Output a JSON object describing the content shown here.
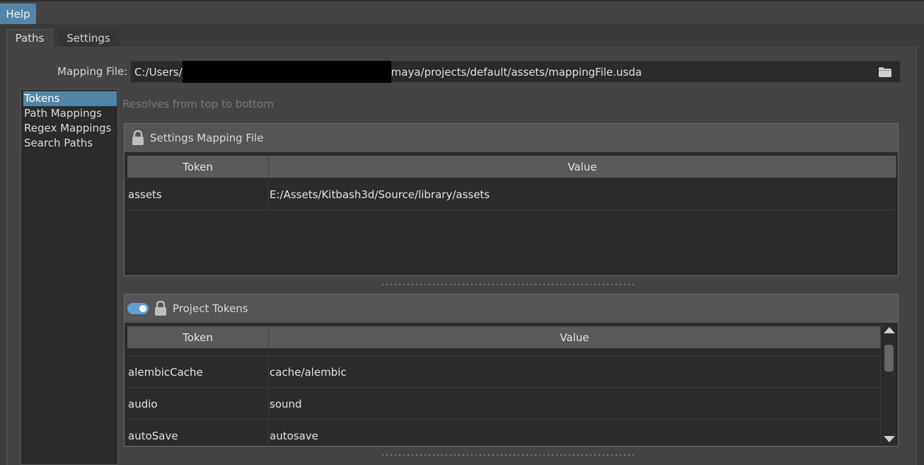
{
  "menu": {
    "help_label": "Help"
  },
  "tabs": [
    {
      "label": "Paths"
    },
    {
      "label": "Settings"
    }
  ],
  "mapping_file": {
    "label": "Mapping File:",
    "value_prefix": "C:/Users/",
    "value_suffix": "maya/projects/default/assets/mappingFile.usda"
  },
  "nav": {
    "items": [
      {
        "label": "Tokens",
        "selected": true
      },
      {
        "label": "Path Mappings"
      },
      {
        "label": "Regex Mappings"
      },
      {
        "label": "Search Paths"
      }
    ]
  },
  "resolves_hint": "Resolves from top to bottom",
  "settings_group": {
    "title": "Settings Mapping File",
    "columns": {
      "token": "Token",
      "value": "Value"
    },
    "rows": [
      {
        "token": "assets",
        "value": "E:/Assets/Kitbash3d/Source/library/assets"
      }
    ]
  },
  "project_group": {
    "title": "Project Tokens",
    "toggle_on": true,
    "columns": {
      "token": "Token",
      "value": "Value"
    },
    "rows": [
      {
        "token": "alembicCache",
        "value": "cache/alembic"
      },
      {
        "token": "audio",
        "value": "sound"
      },
      {
        "token": "autoSave",
        "value": "autosave"
      }
    ]
  },
  "colors": {
    "accent": "#5285a6",
    "toggle": "#5fa0cf",
    "background": "#3b3b3b",
    "field_background": "#2b2b2b"
  }
}
